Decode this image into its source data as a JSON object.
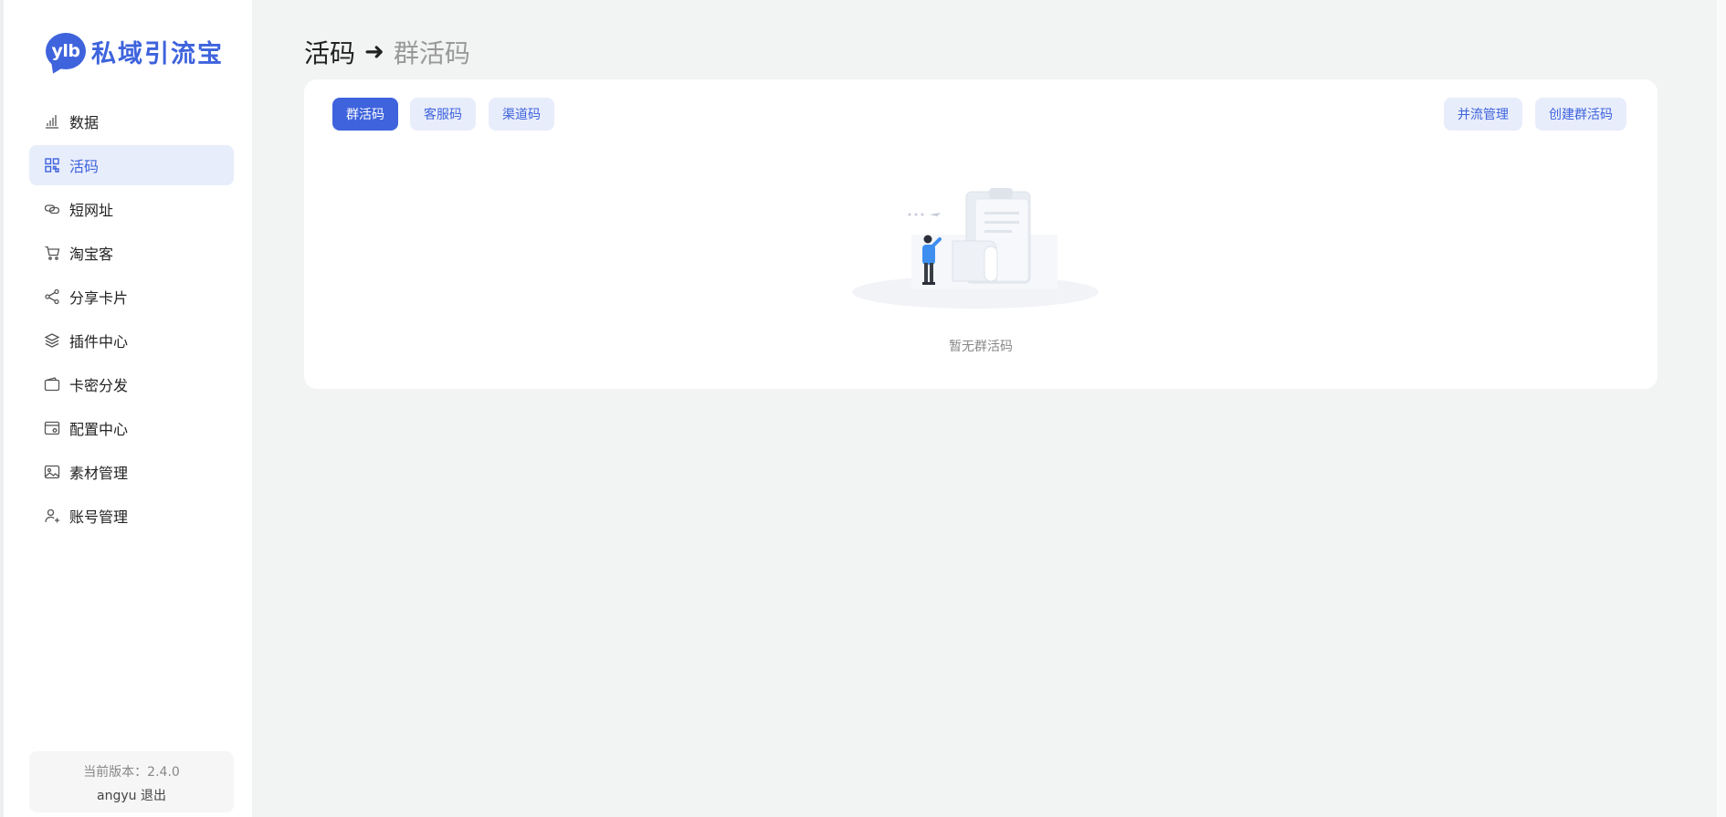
{
  "sidebar": {
    "logo_badge": "ylb",
    "logo_text": "私域引流宝",
    "items": [
      {
        "label": "数据",
        "icon": "bar-chart-icon",
        "active": false
      },
      {
        "label": "活码",
        "icon": "qrcode-icon",
        "active": true
      },
      {
        "label": "短网址",
        "icon": "link-icon",
        "active": false
      },
      {
        "label": "淘宝客",
        "icon": "cart-icon",
        "active": false
      },
      {
        "label": "分享卡片",
        "icon": "share-icon",
        "active": false
      },
      {
        "label": "插件中心",
        "icon": "layers-icon",
        "active": false
      },
      {
        "label": "卡密分发",
        "icon": "wallet-icon",
        "active": false
      },
      {
        "label": "配置中心",
        "icon": "config-icon",
        "active": false
      },
      {
        "label": "素材管理",
        "icon": "image-icon",
        "active": false
      },
      {
        "label": "账号管理",
        "icon": "user-add-icon",
        "active": false
      }
    ],
    "version_label": "当前版本：2.4.0",
    "username": "angyu",
    "logout": "退出"
  },
  "header": {
    "title": "活码",
    "arrow": "➜",
    "subtitle": "群活码"
  },
  "tabs": [
    "群活码",
    "客服码",
    "渠道码"
  ],
  "actions": {
    "merge": "并流管理",
    "create": "创建群活码"
  },
  "empty_state": {
    "text": "暂无群活码"
  },
  "colors": {
    "accent": "#3e63dd",
    "accent_light": "#e8edfb",
    "background": "#f2f3f3"
  }
}
